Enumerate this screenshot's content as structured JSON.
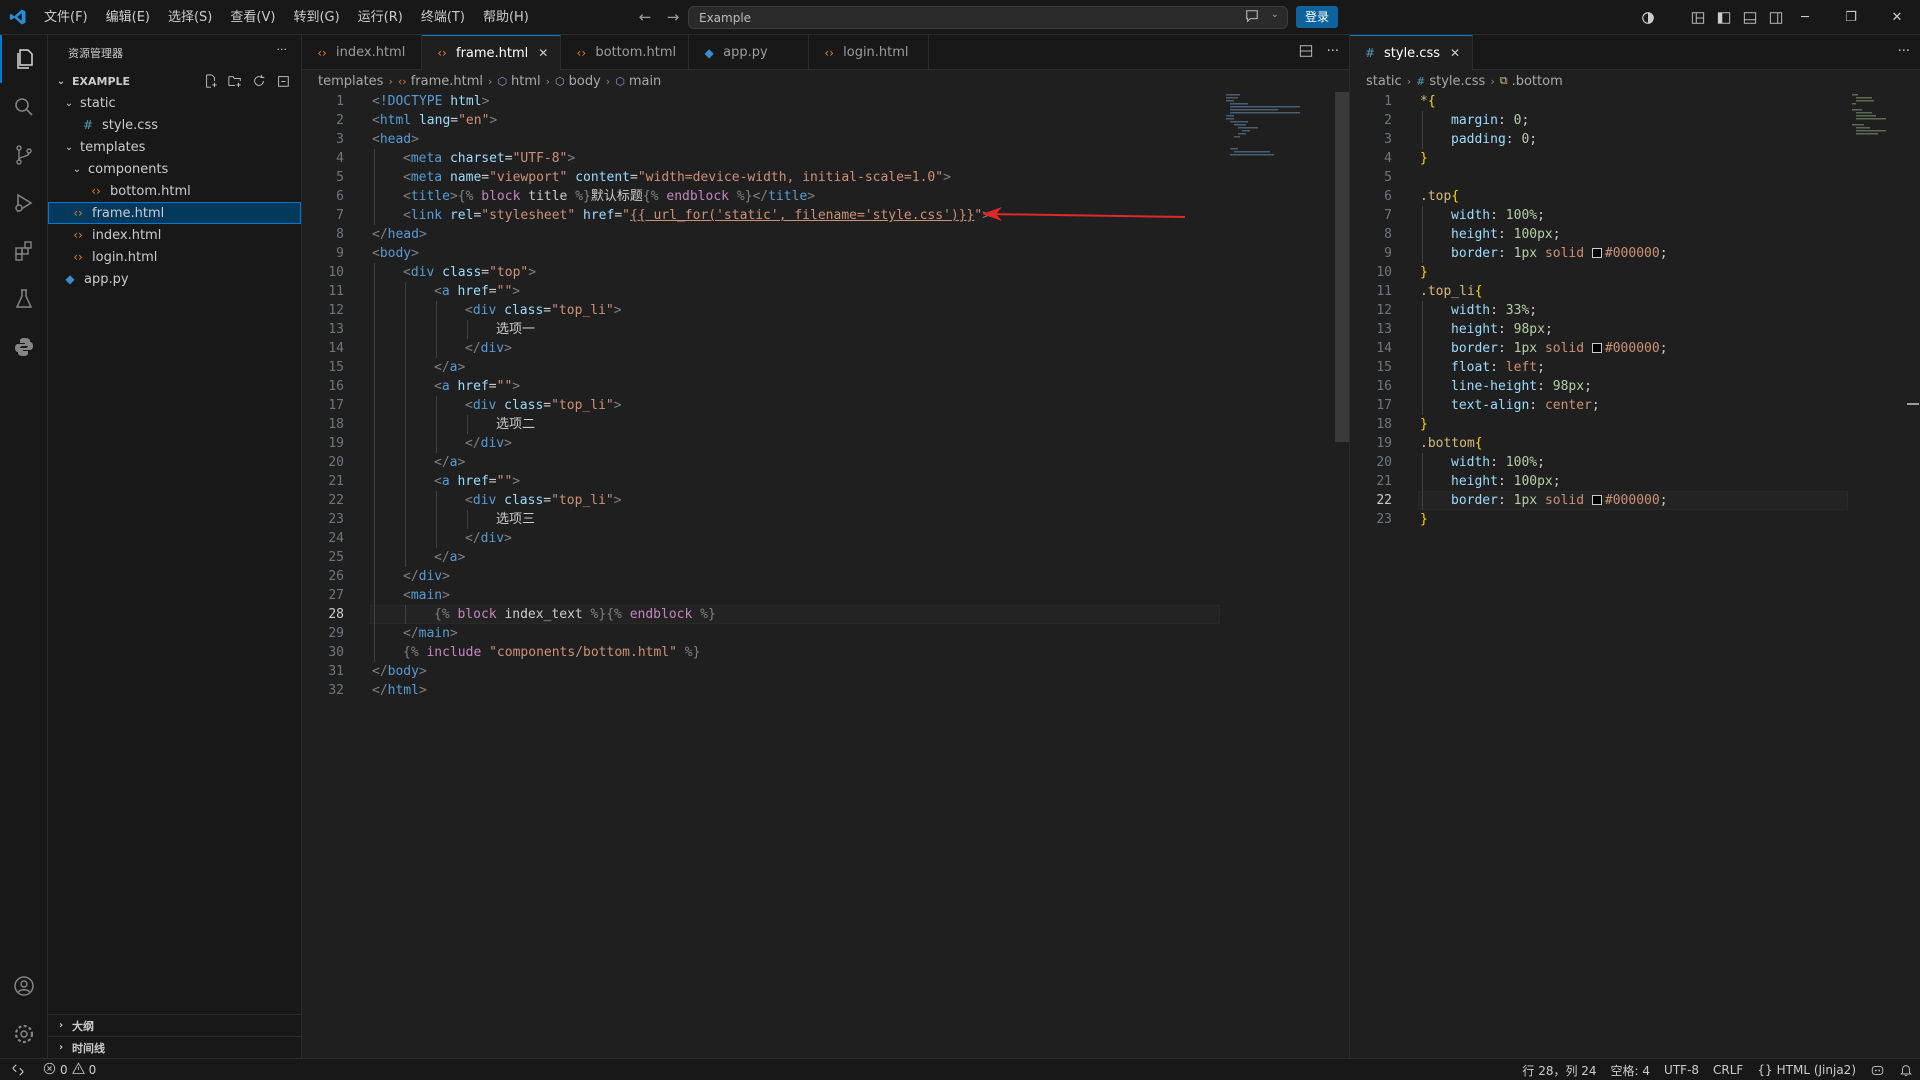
{
  "titlebar": {
    "menu": [
      "文件(F)",
      "编辑(E)",
      "选择(S)",
      "查看(V)",
      "转到(G)",
      "运行(R)",
      "终端(T)",
      "帮助(H)"
    ],
    "search_text": "Example",
    "login_label": "登录"
  },
  "sidebar": {
    "title": "资源管理器",
    "section": "EXAMPLE",
    "tree": [
      {
        "label": "static",
        "kind": "folder",
        "depth": 1
      },
      {
        "label": "style.css",
        "kind": "css",
        "depth": 2
      },
      {
        "label": "templates",
        "kind": "folder",
        "depth": 1
      },
      {
        "label": "components",
        "kind": "folder",
        "depth": 2
      },
      {
        "label": "bottom.html",
        "kind": "html",
        "depth": 3
      },
      {
        "label": "frame.html",
        "kind": "html",
        "depth": 2,
        "selected": true
      },
      {
        "label": "index.html",
        "kind": "html",
        "depth": 2
      },
      {
        "label": "login.html",
        "kind": "html",
        "depth": 2
      },
      {
        "label": "app.py",
        "kind": "py",
        "depth": 1
      }
    ],
    "footer": [
      "大纲",
      "时间线"
    ]
  },
  "editor1": {
    "tabs": [
      {
        "label": "index.html",
        "kind": "html"
      },
      {
        "label": "frame.html",
        "kind": "html",
        "active": true
      },
      {
        "label": "bottom.html",
        "kind": "html"
      },
      {
        "label": "app.py",
        "kind": "py"
      },
      {
        "label": "login.html",
        "kind": "html"
      }
    ],
    "breadcrumb": [
      "templates",
      "frame.html",
      "html",
      "body",
      "main"
    ],
    "current_line": 28
  },
  "editor2": {
    "tabs": [
      {
        "label": "style.css",
        "kind": "css",
        "active": true
      }
    ],
    "breadcrumb": [
      "static",
      "style.css",
      ".bottom"
    ],
    "current_line": 22
  },
  "statusbar": {
    "errors": "0",
    "warnings": "0",
    "position": "行 28，列 24",
    "spaces": "空格: 4",
    "encoding": "UTF-8",
    "eol": "CRLF",
    "language": "HTML (Jinja2)"
  },
  "colors": {
    "accent": "#0078d4",
    "annotation_arrow": "#e0282a"
  }
}
